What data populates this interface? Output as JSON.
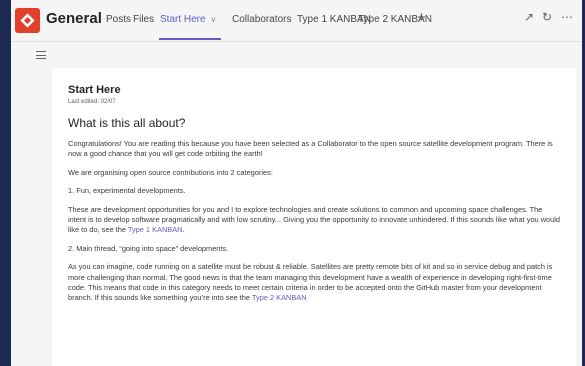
{
  "header": {
    "channel_name": "General",
    "tabs": [
      {
        "label": "Posts"
      },
      {
        "label": "Files"
      },
      {
        "label": "Start Here"
      },
      {
        "label": "Collaborators"
      },
      {
        "label": "Type 1 KANBAN"
      },
      {
        "label": "Type 2 KANBAN"
      }
    ],
    "dropdown_glyph": "∨",
    "add_tab_glyph": "+",
    "icons": {
      "expand": "↗",
      "reload": "↻",
      "more": "⋯"
    }
  },
  "colors": {
    "accent": "#5b5fc7",
    "frame": "#1b2a4e",
    "logo": "#e23f2c"
  },
  "page": {
    "title": "Start Here",
    "last_edited": "Last edited: 02/07",
    "heading": "What is this all about?",
    "p1": "Congratulations! You are reading this because you have been selected as a Collaborator to the open source satellite development program. There is now a good chance that you will get code orbiting the earth!",
    "p2": "We are organising open source contributions into 2 categories:",
    "p3": "1. Fun, experimental developments.",
    "p4_text": "These are development opportunities for you and I to explore technologies and create solutions to common and upcoming space challenges. The intent is to develop software pragmatically and with low scrutiny... Giving you the opportunity to innovate unhindered. If this sounds like what you would like to do, see the ",
    "p4_link": "Type 1 KANBAN",
    "p4_end": ".",
    "p5": "2. Main thread, “going into space” developments.",
    "p6_text": "As you can imagine, code running on a satellite must be robust & reliable. Satellites are pretty remote bits of kit and so in service debug and patch is more challenging than normal. The good news is that the team managing this development have a wealth of experience in developing right-first-time code. This means that code in this category needs to meet certain criteria in order to be accepted onto the GitHub master from your development branch. If this sounds like something you’re into see the ",
    "p6_link": "Type 2 KANBAN"
  }
}
